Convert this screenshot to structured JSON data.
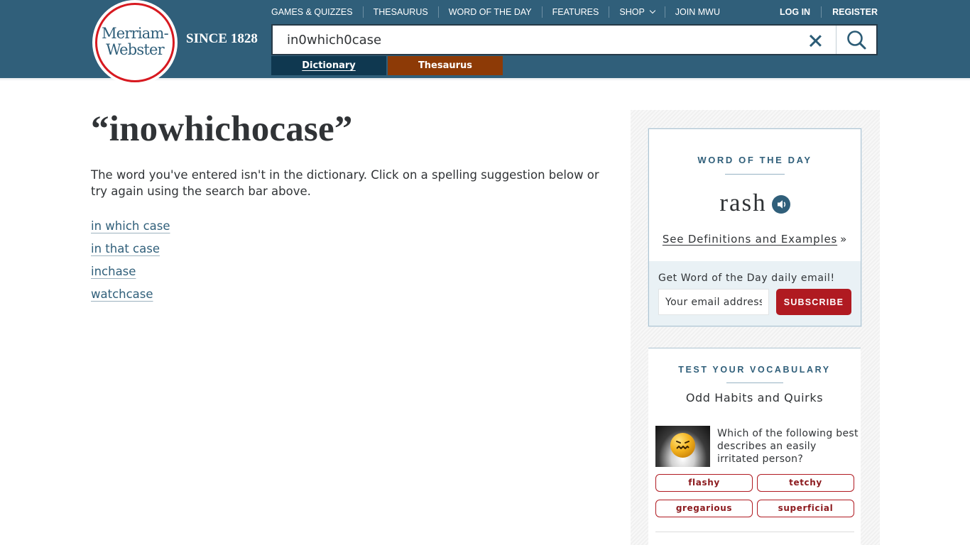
{
  "brand": {
    "logo_line1": "Merriam-",
    "logo_line2": "Webster",
    "since": "SINCE 1828",
    "colors": {
      "header": "#305f7a",
      "dictionary_tab": "#0f3850",
      "thesaurus_tab": "#8d3a06",
      "accent_red": "#b01a21"
    }
  },
  "nav": {
    "items": [
      {
        "label": "GAMES & QUIZZES"
      },
      {
        "label": "THESAURUS"
      },
      {
        "label": "WORD OF THE DAY"
      },
      {
        "label": "FEATURES"
      },
      {
        "label": "SHOP"
      },
      {
        "label": "JOIN MWU"
      }
    ],
    "login": "LOG IN",
    "register": "REGISTER"
  },
  "search": {
    "value": "in0which0case",
    "clear_icon": "close-icon",
    "search_icon": "search-icon"
  },
  "tabs": {
    "dictionary": "Dictionary",
    "thesaurus": "Thesaurus"
  },
  "main": {
    "title": "“inowhichocase”",
    "message": "The word you've entered isn't in the dictionary. Click on a spelling suggestion below or try again using the search bar above.",
    "suggestions": [
      {
        "text": "in which case"
      },
      {
        "text": "in that case"
      },
      {
        "text": "inchase"
      },
      {
        "text": "watchcase"
      }
    ]
  },
  "wod": {
    "label": "WORD OF THE DAY",
    "word": "rash",
    "audio_icon": "speaker-icon",
    "link": "See Definitions and Examples",
    "link_suffix": "»",
    "email_label": "Get Word of the Day daily email!",
    "email_placeholder": "Your email address",
    "subscribe": "SUBSCRIBE"
  },
  "vocab": {
    "label": "TEST YOUR VOCABULARY",
    "subtitle": "Odd Habits and Quirks",
    "question": "Which of the following best describes an easily irritated person?",
    "image_icon": "annoyed-emoji-icon",
    "options": [
      {
        "text": "flashy"
      },
      {
        "text": "tetchy"
      },
      {
        "text": "gregarious"
      },
      {
        "text": "superficial"
      }
    ]
  }
}
